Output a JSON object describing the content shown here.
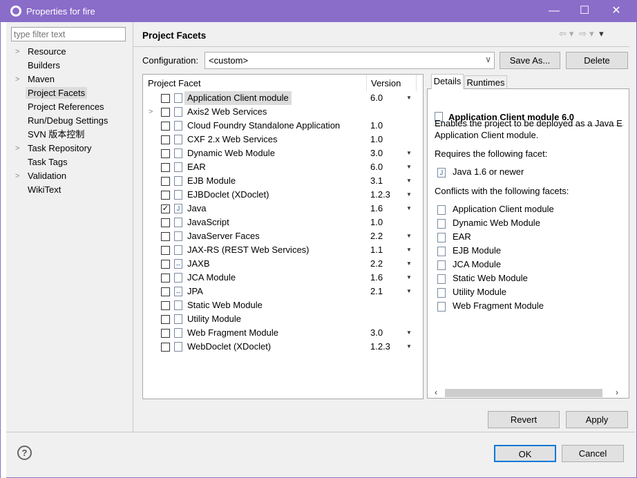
{
  "window": {
    "title": "Properties for fire",
    "minimize": "—",
    "maximize": "☐",
    "close": "✕"
  },
  "filter": {
    "placeholder": "type filter text"
  },
  "tree": [
    {
      "label": "Resource",
      "expandable": true
    },
    {
      "label": "Builders",
      "expandable": false
    },
    {
      "label": "Maven",
      "expandable": true
    },
    {
      "label": "Project Facets",
      "expandable": false,
      "selected": true
    },
    {
      "label": "Project References",
      "expandable": false
    },
    {
      "label": "Run/Debug Settings",
      "expandable": false
    },
    {
      "label": "SVN 版本控制",
      "expandable": false
    },
    {
      "label": "Task Repository",
      "expandable": true
    },
    {
      "label": "Task Tags",
      "expandable": false
    },
    {
      "label": "Validation",
      "expandable": true
    },
    {
      "label": "WikiText",
      "expandable": false
    }
  ],
  "header": {
    "title": "Project Facets",
    "back_icon": "⇦",
    "fwd_icon": "⇨",
    "menu_icon": "▾"
  },
  "config": {
    "label": "Configuration:",
    "value": "<custom>",
    "save_as": "Save As...",
    "delete": "Delete"
  },
  "facets": {
    "col_facet": "Project Facet",
    "col_version": "Version",
    "rows": [
      {
        "name": "Application Client module",
        "version": "6.0",
        "checked": false,
        "dd": true,
        "sel": true
      },
      {
        "name": "Axis2 Web Services",
        "version": "",
        "checked": false,
        "dd": false,
        "exp": true
      },
      {
        "name": "Cloud Foundry Standalone Application",
        "version": "1.0",
        "checked": false,
        "dd": false
      },
      {
        "name": "CXF 2.x Web Services",
        "version": "1.0",
        "checked": false,
        "dd": false
      },
      {
        "name": "Dynamic Web Module",
        "version": "3.0",
        "checked": false,
        "dd": true
      },
      {
        "name": "EAR",
        "version": "6.0",
        "checked": false,
        "dd": true
      },
      {
        "name": "EJB Module",
        "version": "3.1",
        "checked": false,
        "dd": true
      },
      {
        "name": "EJBDoclet (XDoclet)",
        "version": "1.2.3",
        "checked": false,
        "dd": true
      },
      {
        "name": "Java",
        "version": "1.6",
        "checked": true,
        "dd": true
      },
      {
        "name": "JavaScript",
        "version": "1.0",
        "checked": false,
        "dd": false
      },
      {
        "name": "JavaServer Faces",
        "version": "2.2",
        "checked": false,
        "dd": true
      },
      {
        "name": "JAX-RS (REST Web Services)",
        "version": "1.1",
        "checked": false,
        "dd": true
      },
      {
        "name": "JAXB",
        "version": "2.2",
        "checked": false,
        "dd": true
      },
      {
        "name": "JCA Module",
        "version": "1.6",
        "checked": false,
        "dd": true
      },
      {
        "name": "JPA",
        "version": "2.1",
        "checked": false,
        "dd": true
      },
      {
        "name": "Static Web Module",
        "version": "",
        "checked": false,
        "dd": false
      },
      {
        "name": "Utility Module",
        "version": "",
        "checked": false,
        "dd": false
      },
      {
        "name": "Web Fragment Module",
        "version": "3.0",
        "checked": false,
        "dd": true
      },
      {
        "name": "WebDoclet (XDoclet)",
        "version": "1.2.3",
        "checked": false,
        "dd": true
      }
    ]
  },
  "details": {
    "tab_details": "Details",
    "tab_runtimes": "Runtimes",
    "title": "Application Client module 6.0",
    "description": "Enables the project to be deployed as a Java E",
    "description2": "Application Client module.",
    "requires_label": "Requires the following facet:",
    "requires": [
      "Java 1.6 or newer"
    ],
    "conflicts_label": "Conflicts with the following facets:",
    "conflicts": [
      "Application Client module",
      "Dynamic Web Module",
      "EAR",
      "EJB Module",
      "JCA Module",
      "Static Web Module",
      "Utility Module",
      "Web Fragment Module"
    ]
  },
  "buttons": {
    "revert": "Revert",
    "apply": "Apply",
    "ok": "OK",
    "cancel": "Cancel",
    "help": "?"
  }
}
